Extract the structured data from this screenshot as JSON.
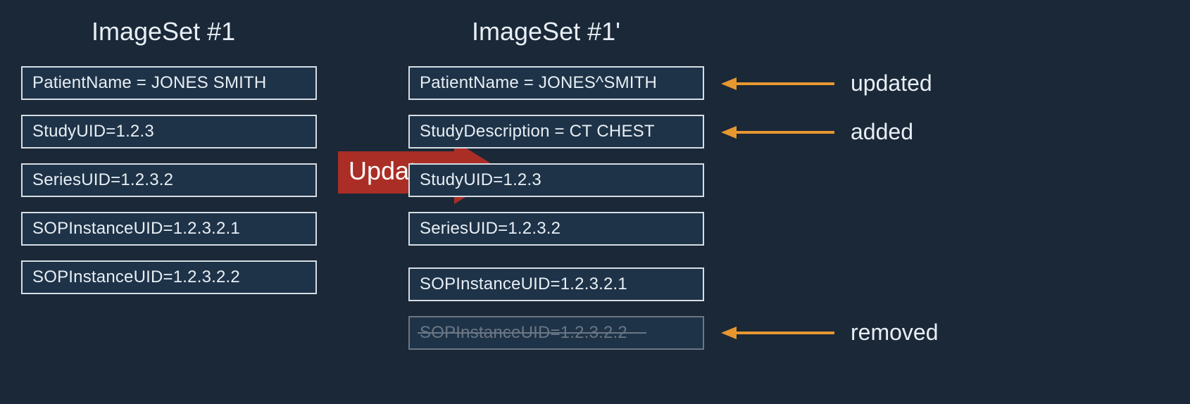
{
  "colors": {
    "bg": "#1a2838",
    "box_fill": "#1e3348",
    "box_border": "#d6dde4",
    "text": "#e8eef4",
    "dim": "#6b7684",
    "arrow_red": "#aa2e25",
    "arrow_orange": "#e79730"
  },
  "left": {
    "title": "ImageSet #1",
    "items": [
      "PatientName = JONES SMITH",
      "StudyUID=1.2.3",
      "SeriesUID=1.2.3.2",
      "SOPInstanceUID=1.2.3.2.1",
      "SOPInstanceUID=1.2.3.2.2"
    ]
  },
  "center": {
    "label": "Update"
  },
  "right": {
    "title": "ImageSet #1'",
    "items": [
      "PatientName = JONES^SMITH",
      "StudyDescription = CT CHEST",
      "StudyUID=1.2.3",
      "SeriesUID=1.2.3.2",
      "SOPInstanceUID=1.2.3.2.1",
      "SOPInstanceUID=1.2.3.2.2"
    ]
  },
  "annotations": {
    "updated": "updated",
    "added": "added",
    "removed": "removed"
  }
}
